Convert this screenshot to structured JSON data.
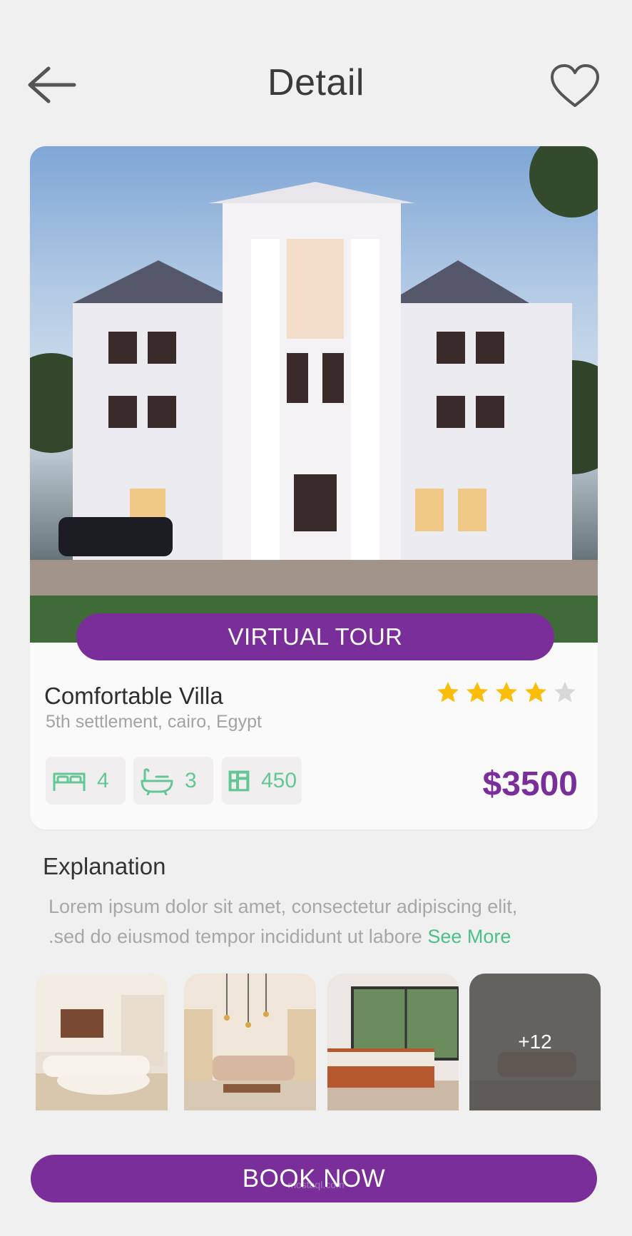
{
  "header": {
    "title": "Detail",
    "back_icon": "arrow-left-icon",
    "favorite_icon": "heart-outline-icon"
  },
  "property": {
    "image_alt": "villa-exterior-photo",
    "virtual_tour_label": "VIRTUAL TOUR",
    "name": "Comfortable Villa",
    "location": "5th settlement, cairo, Egypt",
    "rating": 4,
    "rating_max": 5,
    "price": "$3500",
    "features": [
      {
        "icon": "bed-icon",
        "value": "4"
      },
      {
        "icon": "bathtub-icon",
        "value": "3"
      },
      {
        "icon": "area-icon",
        "value": "450"
      }
    ]
  },
  "explanation": {
    "title": "Explanation",
    "line1": "Lorem ipsum dolor sit amet, consectetur adipiscing elit,",
    "line2": ".sed do eiusmod tempor incididunt ut labore",
    "see_more": "See More"
  },
  "gallery": {
    "more_label": "+12"
  },
  "book_label": "BOOK NOW",
  "watermark": "mostaql.com",
  "colors": {
    "accent": "#7a2e9a",
    "green": "#63c695",
    "star": "#fbbd08",
    "background": "#f0f0f0"
  }
}
